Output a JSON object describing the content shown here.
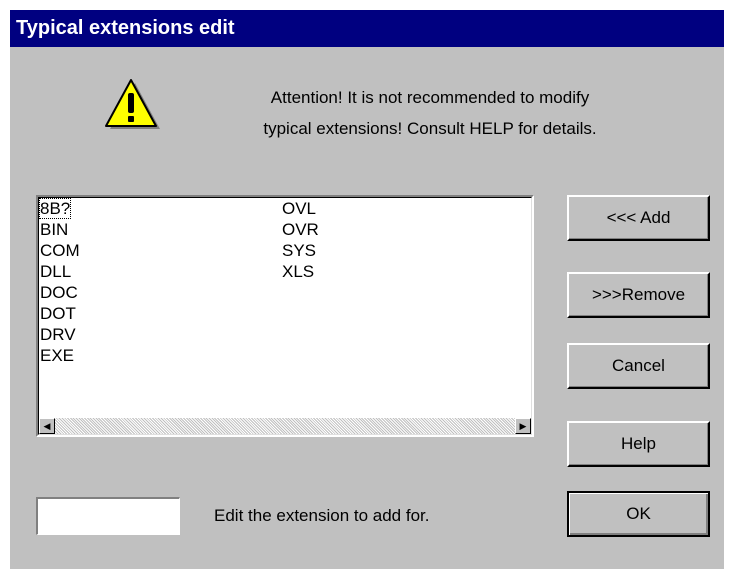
{
  "dialog": {
    "title": "Typical extensions edit",
    "warning_icon": "warning-triangle-icon",
    "message_line1": "Attention! It is not recommended to modify",
    "message_line2": "typical extensions! Consult HELP for details."
  },
  "list": {
    "column1": [
      "8B?",
      "BIN",
      "COM",
      "DLL",
      "DOC",
      "DOT",
      "DRV",
      "EXE"
    ],
    "column2": [
      "OVL",
      "OVR",
      "SYS",
      "XLS"
    ],
    "focused_item": "8B?"
  },
  "buttons": {
    "add": "<<< Add",
    "remove": ">>>Remove",
    "cancel": "Cancel",
    "help": "Help",
    "ok": "OK"
  },
  "input": {
    "value": "",
    "hint": "Edit the extension to add for."
  },
  "colors": {
    "titlebar": "#000080",
    "face": "#c0c0c0",
    "warning_yellow": "#ffff00"
  }
}
